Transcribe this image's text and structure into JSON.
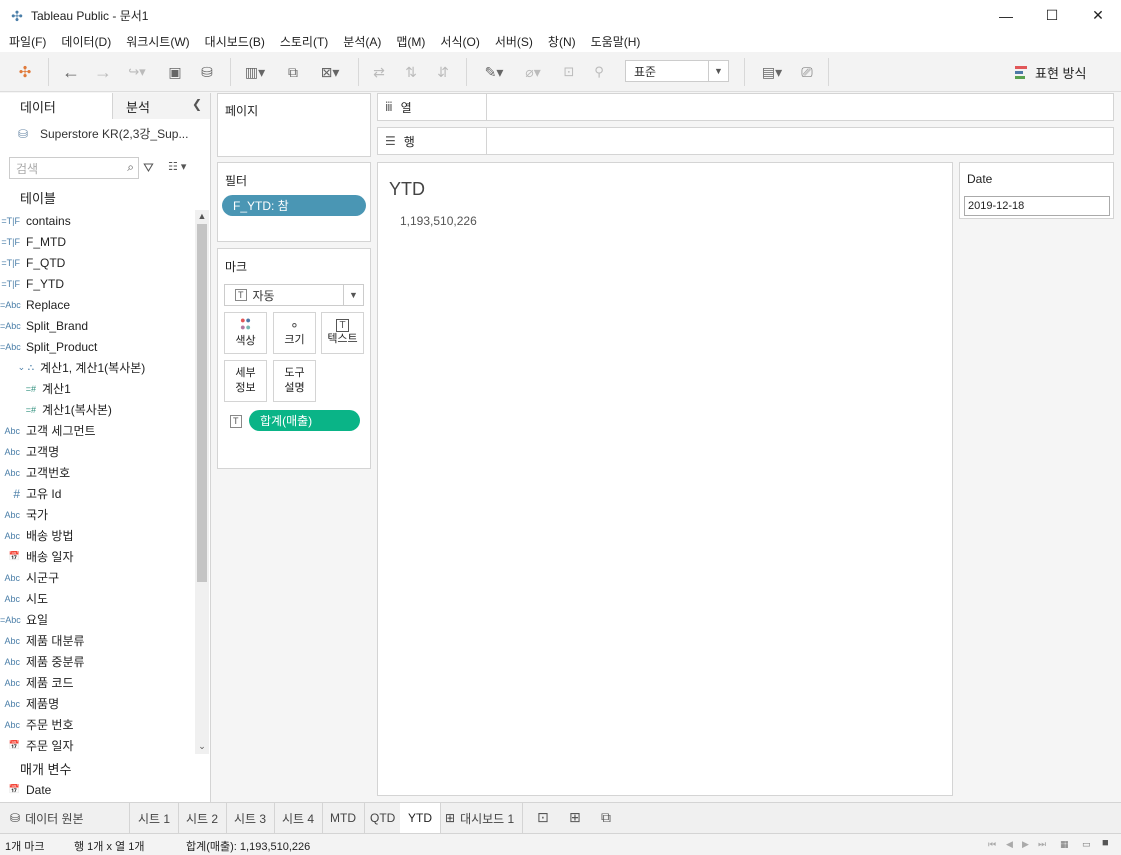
{
  "window": {
    "title": "Tableau Public - 문서1",
    "minimize": "—",
    "maximize": "☐",
    "close": "✕"
  },
  "menu": [
    "파일(F)",
    "데이터(D)",
    "워크시트(W)",
    "대시보드(B)",
    "스토리(T)",
    "분석(A)",
    "맵(M)",
    "서식(O)",
    "서버(S)",
    "창(N)",
    "도움말(H)"
  ],
  "toolbar": {
    "fit_value": "표준",
    "show_me_label": "표현 방식"
  },
  "left_pane": {
    "tab_data": "데이터",
    "tab_analytics": "분석",
    "datasource": "Superstore KR(2,3강_Sup...",
    "search_placeholder": "검색",
    "tables_header": "테이블",
    "fields": [
      {
        "icon": "=T|F",
        "name": "contains"
      },
      {
        "icon": "=T|F",
        "name": "F_MTD"
      },
      {
        "icon": "=T|F",
        "name": "F_QTD"
      },
      {
        "icon": "=T|F",
        "name": "F_YTD"
      },
      {
        "icon": "=Abc",
        "name": "Replace"
      },
      {
        "icon": "=Abc",
        "name": "Split_Brand"
      },
      {
        "icon": "=Abc",
        "name": "Split_Product"
      },
      {
        "icon": "⛬",
        "name": "계산1, 계산1(복사본)"
      },
      {
        "icon": "=#",
        "name": "계산1"
      },
      {
        "icon": "=#",
        "name": "계산1(복사본)"
      },
      {
        "icon": "Abc",
        "name": "고객 세그먼트"
      },
      {
        "icon": "Abc",
        "name": "고객명"
      },
      {
        "icon": "Abc",
        "name": "고객번호"
      },
      {
        "icon": "#",
        "name": "고유 Id"
      },
      {
        "icon": "Abc",
        "name": "국가"
      },
      {
        "icon": "Abc",
        "name": "배송 방법"
      },
      {
        "icon": "📅",
        "name": "배송 일자"
      },
      {
        "icon": "Abc",
        "name": "시군구"
      },
      {
        "icon": "Abc",
        "name": "시도"
      },
      {
        "icon": "=Abc",
        "name": "요일"
      },
      {
        "icon": "Abc",
        "name": "제품 대분류"
      },
      {
        "icon": "Abc",
        "name": "제품 중분류"
      },
      {
        "icon": "Abc",
        "name": "제품 코드"
      },
      {
        "icon": "Abc",
        "name": "제품명"
      },
      {
        "icon": "Abc",
        "name": "주문 번호"
      },
      {
        "icon": "📅",
        "name": "주문 일자"
      }
    ],
    "params_header": "매개 변수",
    "params": [
      {
        "icon": "📅",
        "name": "Date"
      }
    ]
  },
  "pages_card": {
    "title": "페이지"
  },
  "filters_card": {
    "title": "필터",
    "pill": "F_YTD: 참"
  },
  "marks_card": {
    "title": "마크",
    "type": "자동",
    "color": "색상",
    "size": "크기",
    "text": "텍스트",
    "detail_line1": "세부",
    "detail_line2": "정보",
    "tooltip_line1": "도구",
    "tooltip_line2": "설명",
    "pill": "합계(매출)"
  },
  "shelves": {
    "columns": "열",
    "rows": "행"
  },
  "viz": {
    "title": "YTD",
    "value": "1,193,510,226"
  },
  "parameter_card": {
    "title": "Date",
    "value": "2019-12-18"
  },
  "sheet_tabs": {
    "datasource": "데이터 원본",
    "tabs": [
      "시트 1",
      "시트 2",
      "시트 3",
      "시트 4",
      "MTD",
      "QTD",
      "YTD"
    ],
    "active": "YTD",
    "dashboard": "대시보드 1"
  },
  "status": {
    "marks": "1개 마크",
    "rows_cols": "행 1개 x 열 1개",
    "sum": "합계(매출): 1,193,510,226"
  }
}
